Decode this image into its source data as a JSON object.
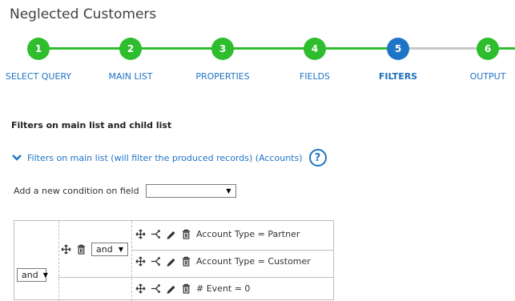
{
  "page": {
    "title": "Neglected Customers"
  },
  "wizard": {
    "steps": [
      {
        "number": "1",
        "label": "SELECT QUERY",
        "state": "complete"
      },
      {
        "number": "2",
        "label": "MAIN LIST",
        "state": "complete"
      },
      {
        "number": "3",
        "label": "PROPERTIES",
        "state": "complete"
      },
      {
        "number": "4",
        "label": "FIELDS",
        "state": "complete"
      },
      {
        "number": "5",
        "label": "FILTERS",
        "state": "active"
      },
      {
        "number": "6",
        "label": "OUTPUT",
        "state": "pending"
      }
    ],
    "colors": {
      "complete": "#2dbd2d",
      "active": "#1e74c6",
      "pending_line": "#c8c8c8"
    }
  },
  "filters": {
    "section_title": "Filters on main list and child list",
    "main_list_toggle": "Filters on main list (will filter the produced records) (Accounts)",
    "help_icon": "?",
    "add_condition_label": "Add a new condition on field",
    "add_condition_value": "",
    "outer_operator": "and",
    "inner_operator": "and",
    "conditions": [
      {
        "text": "Account Type = Partner"
      },
      {
        "text": "Account Type = Customer"
      },
      {
        "text": "# Event = 0"
      }
    ]
  },
  "icons": {
    "move": "move-icon",
    "delete": "trash-icon",
    "branch": "branch-icon",
    "edit": "pencil-icon",
    "collapse": "chevron-down-icon",
    "help": "help-icon"
  }
}
